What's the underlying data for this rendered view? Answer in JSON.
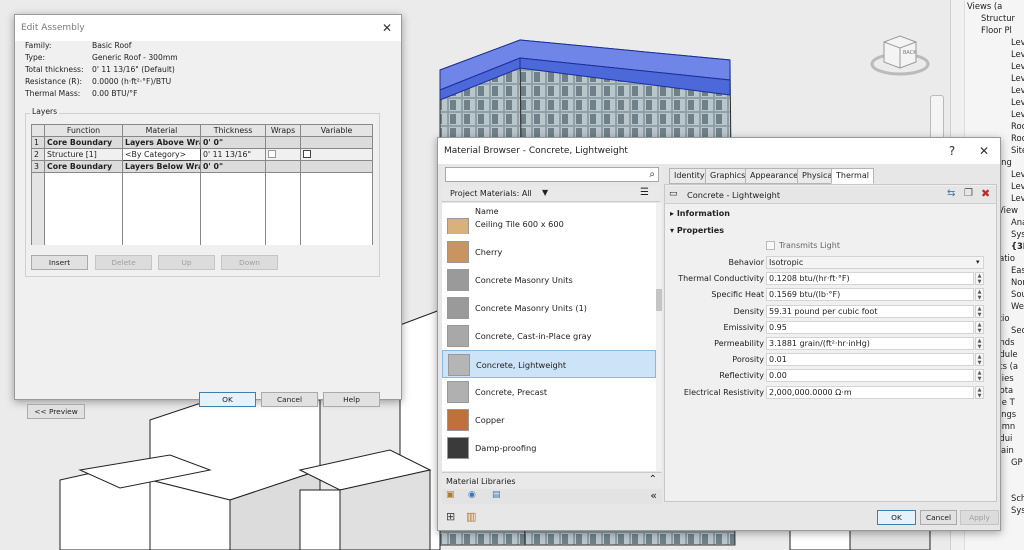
{
  "edit_assembly": {
    "title": "Edit Assembly",
    "close": "✕",
    "info": [
      {
        "label": "Family:",
        "value": "Basic Roof"
      },
      {
        "label": "Type:",
        "value": "Generic Roof - 300mm"
      },
      {
        "label": "Total thickness:",
        "value": "0'  11 13/16\" (Default)"
      },
      {
        "label": "Resistance (R):",
        "value": "0.0000 (h·ft²·°F)/BTU"
      },
      {
        "label": "Thermal Mass:",
        "value": "0.00 BTU/°F"
      }
    ],
    "layers_group": "Layers",
    "columns": [
      "",
      "Function",
      "Material",
      "Thickness",
      "Wraps",
      "Variable"
    ],
    "rows": [
      {
        "num": "1",
        "function": "Core Boundary",
        "material": "Layers Above Wrap",
        "thickness": "0'  0\""
      },
      {
        "num": "2",
        "function": "Structure [1]",
        "material": "<By Category>",
        "thickness": "0'  11 13/16\""
      },
      {
        "num": "3",
        "function": "Core Boundary",
        "material": "Layers Below Wrap",
        "thickness": "0'  0\""
      }
    ],
    "buttons": {
      "insert": "Insert",
      "delete": "Delete",
      "up": "Up",
      "down": "Down",
      "ok": "OK",
      "cancel": "Cancel",
      "help": "Help",
      "preview": "<< Preview"
    }
  },
  "material_browser": {
    "title": "Material Browser - Concrete, Lightweight",
    "help": "?",
    "close": "✕",
    "search_placeholder": "",
    "search_icon": "search-icon",
    "filter_label": "Project Materials: All",
    "list_header": "Name",
    "materials": [
      {
        "name": "Ceiling Tile 600 x 600",
        "color": "#d9b27a"
      },
      {
        "name": "Cherry",
        "color": "#c89460"
      },
      {
        "name": "Concrete Masonry Units",
        "color": "#9a9a9a"
      },
      {
        "name": "Concrete Masonry Units (1)",
        "color": "#9a9a9a"
      },
      {
        "name": "Concrete, Cast-in-Place gray",
        "color": "#a8a8a8"
      },
      {
        "name": "Concrete, Lightweight",
        "color": "#b5b5b5"
      },
      {
        "name": "Concrete, Precast",
        "color": "#b0b0b0"
      },
      {
        "name": "Copper",
        "color": "#c0703a"
      },
      {
        "name": "Damp-proofing",
        "color": "#3a3a3a"
      }
    ],
    "selected_index": 5,
    "libraries_label": "Material Libraries",
    "tabs": [
      "Identity",
      "Graphics",
      "Appearance",
      "Physical",
      "Thermal"
    ],
    "active_tab": "Thermal",
    "asset_name": "Concrete - Lightweight",
    "sections": {
      "information": "Information",
      "properties": "Properties"
    },
    "transmits_light": "Transmits Light",
    "properties": [
      {
        "label": "Behavior",
        "value": "Isotropic"
      },
      {
        "label": "Thermal Conductivity",
        "value": "0.1208 btu/(hr·ft·°F)"
      },
      {
        "label": "Specific Heat",
        "value": "0.1569 btu/(lb·°F)"
      },
      {
        "label": "Density",
        "value": "59.31 pound per cubic foot"
      },
      {
        "label": "Emissivity",
        "value": "0.95"
      },
      {
        "label": "Permeability",
        "value": "3.1881 grain/(ft²·hr·inHg)"
      },
      {
        "label": "Porosity",
        "value": "0.01"
      },
      {
        "label": "Reflectivity",
        "value": "0.00"
      },
      {
        "label": "Electrical Resistivity",
        "value": "2,000,000.0000 Ω·m"
      }
    ],
    "buttons": {
      "ok": "OK",
      "cancel": "Cancel",
      "apply": "Apply"
    }
  },
  "project_browser": {
    "items": [
      {
        "text": "Views (a",
        "indent": 0
      },
      {
        "text": "Structur",
        "indent": 1
      },
      {
        "text": "Floor Pl",
        "indent": 1
      },
      {
        "text": "Lev",
        "indent": 3
      },
      {
        "text": "Lev",
        "indent": 3
      },
      {
        "text": "Lev",
        "indent": 3
      },
      {
        "text": "Lev",
        "indent": 3
      },
      {
        "text": "Lev",
        "indent": 3
      },
      {
        "text": "Lev",
        "indent": 3
      },
      {
        "text": "Lev",
        "indent": 3
      },
      {
        "text": "Roc",
        "indent": 3
      },
      {
        "text": "Roc",
        "indent": 3
      },
      {
        "text": "Site",
        "indent": 3
      },
      {
        "text": "eiling",
        "indent": 2
      },
      {
        "text": "Lev",
        "indent": 3
      },
      {
        "text": "Lev",
        "indent": 3
      },
      {
        "text": "Lev",
        "indent": 3
      },
      {
        "text": "D View",
        "indent": 2
      },
      {
        "text": "Ana",
        "indent": 3
      },
      {
        "text": "Syst",
        "indent": 3
      },
      {
        "text": "{3D",
        "indent": 3
      },
      {
        "text": "evatio",
        "indent": 2
      },
      {
        "text": "East",
        "indent": 3
      },
      {
        "text": "Nor",
        "indent": 3
      },
      {
        "text": "Sou",
        "indent": 3
      },
      {
        "text": "Wes",
        "indent": 3
      },
      {
        "text": "ectio",
        "indent": 2
      },
      {
        "text": "Sect",
        "indent": 3
      },
      {
        "text": "gends",
        "indent": 2
      },
      {
        "text": "hedule",
        "indent": 2
      },
      {
        "text": "eets (a",
        "indent": 2
      },
      {
        "text": "milies",
        "indent": 2
      },
      {
        "text": "nnota",
        "indent": 2
      },
      {
        "text": "able T",
        "indent": 2
      },
      {
        "text": "eilings",
        "indent": 2
      },
      {
        "text": "olumn",
        "indent": 2
      },
      {
        "text": "ondui",
        "indent": 2
      },
      {
        "text": "urtain",
        "indent": 2
      },
      {
        "text": "GP",
        "indent": 3
      },
      {
        "text": "",
        "indent": 3
      },
      {
        "text": "",
        "indent": 3
      },
      {
        "text": "Sch",
        "indent": 3
      },
      {
        "text": "Syst",
        "indent": 3
      }
    ]
  },
  "viewcube": {
    "label": "BACK"
  }
}
